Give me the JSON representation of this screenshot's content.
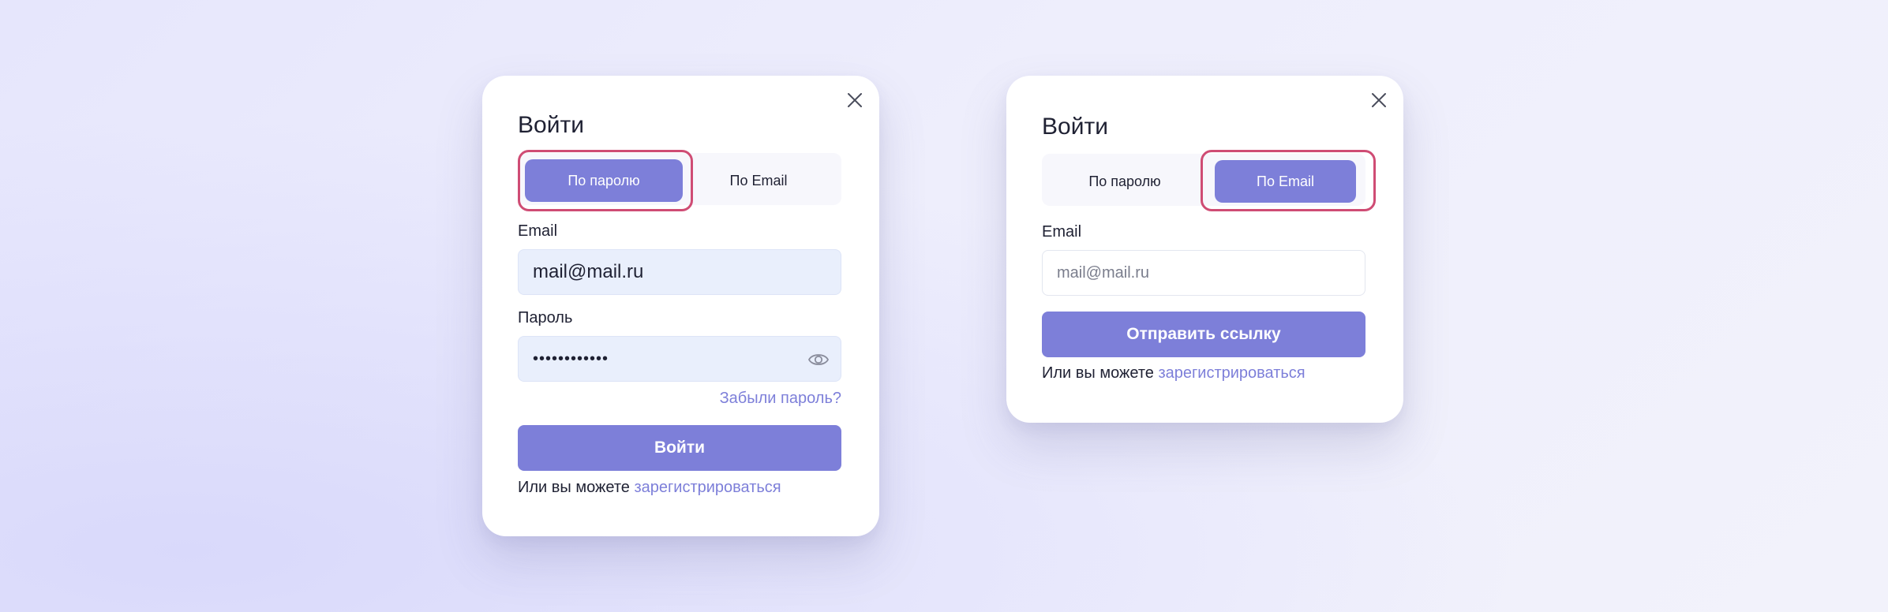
{
  "password_card": {
    "title": "Войти",
    "tabs": [
      {
        "label": "По паролю",
        "active": true
      },
      {
        "label": "По Email",
        "active": false
      }
    ],
    "email_label": "Email",
    "email_value": "mail@mail.ru",
    "password_label": "Пароль",
    "password_value": "••••••••••••",
    "forgot_link": "Забыли пароль?",
    "submit_label": "Войти",
    "footer_text": "Или вы можете",
    "register_link": "зарегистрироваться"
  },
  "email_card": {
    "title": "Войти",
    "tabs": [
      {
        "label": "По паролю",
        "active": false
      },
      {
        "label": "По Email",
        "active": true
      }
    ],
    "email_label": "Email",
    "email_placeholder": "mail@mail.ru",
    "submit_label": "Отправить ссылку",
    "footer_text": "Или вы можете",
    "register_link": "зарегистрироваться"
  },
  "colors": {
    "accent": "#7d7fd9",
    "highlight": "#cf4c74",
    "input_fill": "#e9effc",
    "text": "#1f2133"
  },
  "icons": [
    "close-icon",
    "eye-icon"
  ]
}
